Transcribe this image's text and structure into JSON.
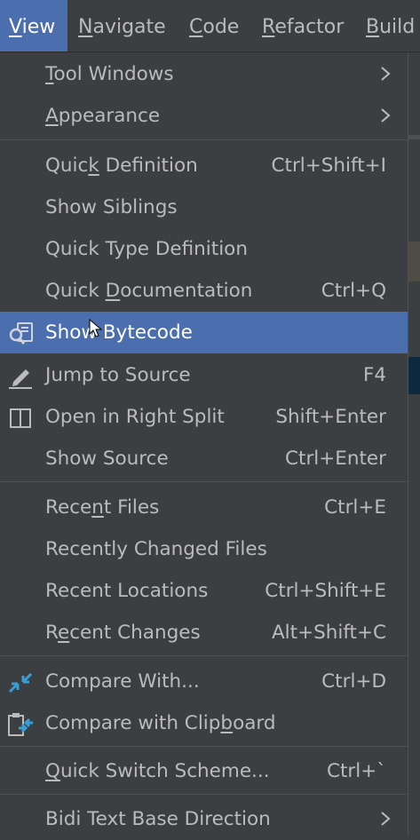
{
  "menubar": [
    {
      "label": "View",
      "mn": "V",
      "rest": "iew",
      "active": true
    },
    {
      "label": "Navigate",
      "mn": "N",
      "rest": "avigate"
    },
    {
      "label": "Code",
      "mn": "C",
      "rest": "ode"
    },
    {
      "label": "Refactor",
      "mn": "R",
      "rest": "efactor"
    },
    {
      "label": "Build",
      "mn": "B",
      "rest": "uild"
    }
  ],
  "menu": {
    "items": [
      {
        "label": "Tool Windows",
        "shortcut": "",
        "submenu": true
      },
      {
        "label": "Appearance",
        "shortcut": "",
        "submenu": true
      },
      {
        "label": "Quick Definition",
        "shortcut": "Ctrl+Shift+I"
      },
      {
        "label": "Show Siblings",
        "shortcut": ""
      },
      {
        "label": "Quick Type Definition",
        "shortcut": ""
      },
      {
        "label": "Quick Documentation",
        "shortcut": "Ctrl+Q"
      },
      {
        "label": "Show Bytecode",
        "shortcut": "",
        "selected": true,
        "icon": "bytecode-search-icon"
      },
      {
        "label": "Jump to Source",
        "shortcut": "F4",
        "icon": "pencil-icon"
      },
      {
        "label": "Open in Right Split",
        "shortcut": "Shift+Enter",
        "icon": "split-view-icon"
      },
      {
        "label": "Show Source",
        "shortcut": "Ctrl+Enter"
      },
      {
        "label": "Recent Files",
        "shortcut": "Ctrl+E"
      },
      {
        "label": "Recently Changed Files",
        "shortcut": ""
      },
      {
        "label": "Recent Locations",
        "shortcut": "Ctrl+Shift+E"
      },
      {
        "label": "Recent Changes",
        "shortcut": "Alt+Shift+C"
      },
      {
        "label": "Compare With...",
        "shortcut": "Ctrl+D",
        "icon": "compare-arrows-icon"
      },
      {
        "label": "Compare with Clipboard",
        "shortcut": "",
        "icon": "compare-clipboard-icon"
      },
      {
        "label": "Quick Switch Scheme...",
        "shortcut": "Ctrl+`"
      },
      {
        "label": "Bidi Text Base Direction",
        "shortcut": "",
        "submenu": true
      }
    ]
  },
  "colors": {
    "background": "#3c3f41",
    "selection": "#4b6eaf",
    "text": "#bbbbbb",
    "separator": "#515151"
  }
}
